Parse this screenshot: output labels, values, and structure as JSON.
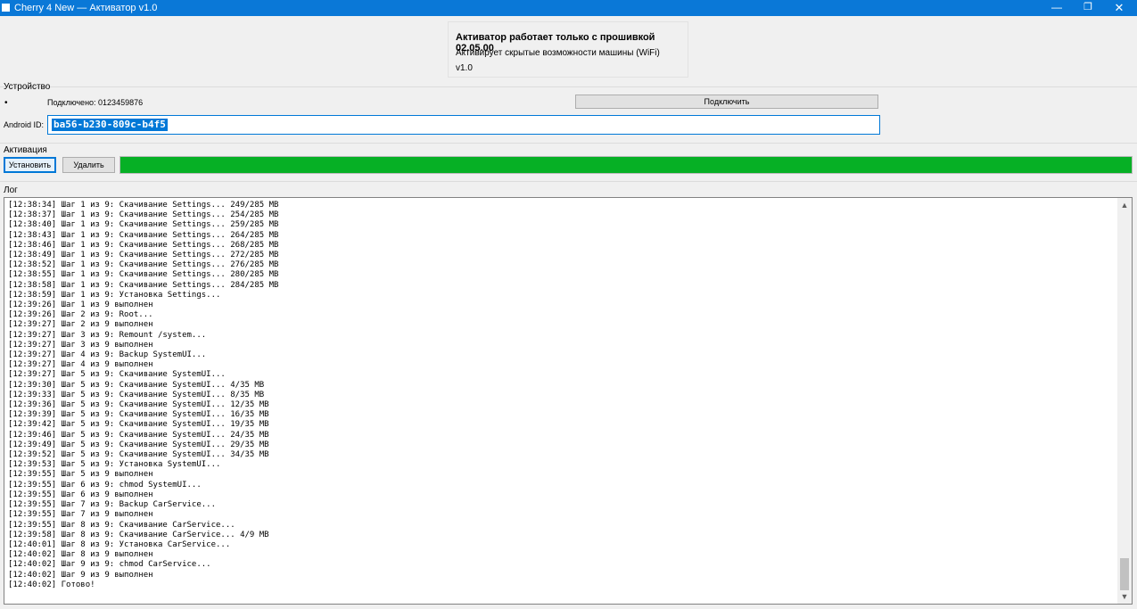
{
  "window": {
    "title": "Cherry 4 New — Активатор v1.0",
    "controls": {
      "minimize": "—",
      "maximize": "❐",
      "close": "✕"
    }
  },
  "info": {
    "title": "Активатор работает только с прошивкой 02.05.00",
    "subtitle": "Активирует скрытые возможности машины (WiFi)",
    "version": "v1.0"
  },
  "device": {
    "group_label": "Устройство",
    "bullet": "•",
    "status": "Подключено: 0123459876",
    "connect_label": "Подключить",
    "android_id_label": "Android ID:",
    "android_id_value": "ba56-b230-809c-b4f5"
  },
  "activation": {
    "group_label": "Активация",
    "install_label": "Установить",
    "delete_label": "Удалить",
    "progress": 1.0,
    "progress_color": "#06b025"
  },
  "log": {
    "group_label": "Лог",
    "lines": [
      "[12:38:34] Шаг 1 из 9: Скачивание Settings... 249/285 MB",
      "[12:38:37] Шаг 1 из 9: Скачивание Settings... 254/285 MB",
      "[12:38:40] Шаг 1 из 9: Скачивание Settings... 259/285 MB",
      "[12:38:43] Шаг 1 из 9: Скачивание Settings... 264/285 MB",
      "[12:38:46] Шаг 1 из 9: Скачивание Settings... 268/285 MB",
      "[12:38:49] Шаг 1 из 9: Скачивание Settings... 272/285 MB",
      "[12:38:52] Шаг 1 из 9: Скачивание Settings... 276/285 MB",
      "[12:38:55] Шаг 1 из 9: Скачивание Settings... 280/285 MB",
      "[12:38:58] Шаг 1 из 9: Скачивание Settings... 284/285 MB",
      "[12:38:59] Шаг 1 из 9: Установка Settings...",
      "[12:39:26] Шаг 1 из 9 выполнен",
      "[12:39:26] Шаг 2 из 9: Root...",
      "[12:39:27] Шаг 2 из 9 выполнен",
      "[12:39:27] Шаг 3 из 9: Remount /system...",
      "[12:39:27] Шаг 3 из 9 выполнен",
      "[12:39:27] Шаг 4 из 9: Backup SystemUI...",
      "[12:39:27] Шаг 4 из 9 выполнен",
      "[12:39:27] Шаг 5 из 9: Скачивание SystemUI...",
      "[12:39:30] Шаг 5 из 9: Скачивание SystemUI... 4/35 MB",
      "[12:39:33] Шаг 5 из 9: Скачивание SystemUI... 8/35 MB",
      "[12:39:36] Шаг 5 из 9: Скачивание SystemUI... 12/35 MB",
      "[12:39:39] Шаг 5 из 9: Скачивание SystemUI... 16/35 MB",
      "[12:39:42] Шаг 5 из 9: Скачивание SystemUI... 19/35 MB",
      "[12:39:46] Шаг 5 из 9: Скачивание SystemUI... 24/35 MB",
      "[12:39:49] Шаг 5 из 9: Скачивание SystemUI... 29/35 MB",
      "[12:39:52] Шаг 5 из 9: Скачивание SystemUI... 34/35 MB",
      "[12:39:53] Шаг 5 из 9: Установка SystemUI...",
      "[12:39:55] Шаг 5 из 9 выполнен",
      "[12:39:55] Шаг 6 из 9: chmod SystemUI...",
      "[12:39:55] Шаг 6 из 9 выполнен",
      "[12:39:55] Шаг 7 из 9: Backup CarService...",
      "[12:39:55] Шаг 7 из 9 выполнен",
      "[12:39:55] Шаг 8 из 9: Скачивание CarService...",
      "[12:39:58] Шаг 8 из 9: Скачивание CarService... 4/9 MB",
      "[12:40:01] Шаг 8 из 9: Установка CarService...",
      "[12:40:02] Шаг 8 из 9 выполнен",
      "[12:40:02] Шаг 9 из 9: chmod CarService...",
      "[12:40:02] Шаг 9 из 9 выполнен",
      "[12:40:02] Готово!"
    ],
    "scroll_up": "▲",
    "scroll_down": "▼"
  }
}
